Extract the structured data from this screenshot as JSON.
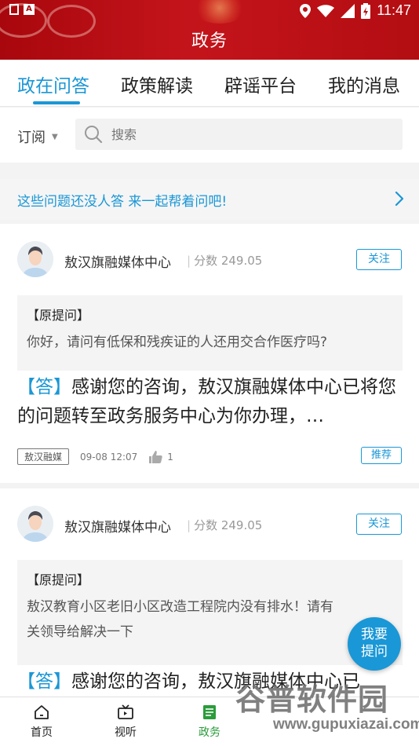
{
  "status_bar": {
    "time": "11:47",
    "notif_letter": "A"
  },
  "header": {
    "title": "政务"
  },
  "tabs": [
    {
      "label": "政在问答",
      "active": true
    },
    {
      "label": "政策解读",
      "active": false
    },
    {
      "label": "辟谣平台",
      "active": false
    },
    {
      "label": "我的消息",
      "active": false
    }
  ],
  "filter": {
    "subscribe_label": "订阅",
    "search_placeholder": "搜索"
  },
  "banner": {
    "text": "这些问题还没人答 来一起帮着问吧!"
  },
  "posts": [
    {
      "author": "敖汉旗融媒体中心",
      "score": "分数 249.05",
      "follow_label": "关注",
      "question_label": "【原提问】",
      "question": "你好，请问有低保和残疾证的人还用交合作医疗吗?",
      "answer_label": "【答】",
      "answer": "感谢您的咨询，敖汉旗融媒体中心已将您的问题转至政务服务中心为你办理，…",
      "tag": "敖汉融媒",
      "time": "09-08 12:07",
      "likes": "1",
      "recommend_label": "推荐"
    },
    {
      "author": "敖汉旗融媒体中心",
      "score": "分数 249.05",
      "follow_label": "关注",
      "question_label": "【原提问】",
      "question": "敖汉教育小区老旧小区改造工程院内没有排水！请有关领导给解决一下",
      "answer_label": "【答】",
      "answer": "感谢您的咨询，敖汉旗融媒体中心已"
    }
  ],
  "ask_button": {
    "line1": "我要",
    "line2": "提问"
  },
  "bottom_nav": [
    {
      "label": "首页",
      "icon": "home-icon"
    },
    {
      "label": "视听",
      "icon": "tv-icon"
    },
    {
      "label": "政务",
      "icon": "news-icon",
      "active": true
    }
  ],
  "watermark": {
    "title": "谷普软件园",
    "url": "www.gupuxiazai.com"
  },
  "colors": {
    "accent": "#1a97d6",
    "header_red": "#b30d12",
    "nav_active": "#2b9c3b"
  }
}
